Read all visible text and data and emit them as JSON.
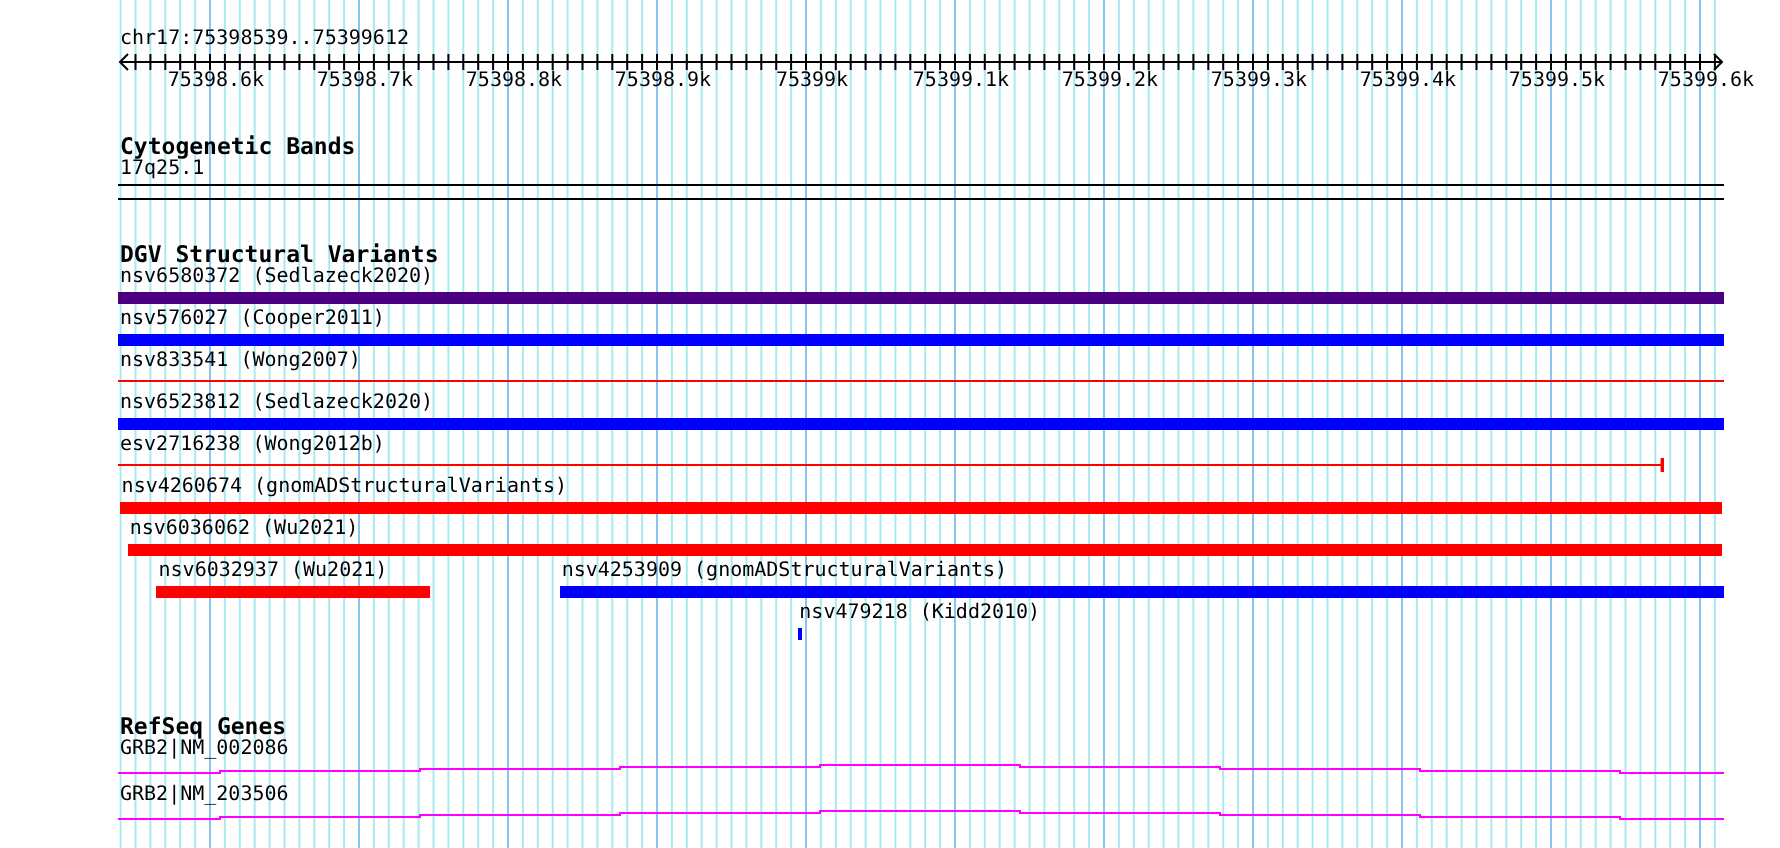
{
  "ruler": {
    "location": "chr17:75398539..75399612",
    "ticks": [
      "75398.6k",
      "75398.7k",
      "75398.8k",
      "75398.9k",
      "75399k",
      "75399.1k",
      "75399.2k",
      "75399.3k",
      "75399.4k",
      "75399.5k",
      "75399.6k"
    ]
  },
  "cytogenetic_bands": {
    "title": "Cytogenetic Bands",
    "band": "17q25.1"
  },
  "dgv": {
    "title": "DGV Structural Variants",
    "features": [
      {
        "label": "nsv6580372 (Sedlazeck2020)",
        "kind": "bar",
        "color": "#4b0082"
      },
      {
        "label": "nsv576027 (Cooper2011)",
        "kind": "bar",
        "color": "#0000ff"
      },
      {
        "label": "nsv833541 (Wong2007)",
        "kind": "line",
        "color": "#ff0000"
      },
      {
        "label": "nsv6523812 (Sedlazeck2020)",
        "kind": "bar",
        "color": "#0000ff"
      },
      {
        "label": "esv2716238 (Wong2012b)",
        "kind": "capped_line",
        "color": "#ff0000"
      },
      {
        "label": "nsv4260674 (gnomADStructuralVariants)",
        "kind": "bar",
        "color": "#ff0000"
      },
      {
        "label": "nsv6036062 (Wu2021)",
        "kind": "bar",
        "color": "#ff0000"
      },
      {
        "label": "nsv6032937 (Wu2021)",
        "kind": "bar",
        "color": "#ff0000"
      },
      {
        "label": "nsv4253909 (gnomADStructuralVariants)",
        "kind": "bar",
        "color": "#0000ff"
      },
      {
        "label": "nsv479218 (Kidd2010)",
        "kind": "bar",
        "color": "#0000ff"
      }
    ]
  },
  "refseq": {
    "title": "RefSeq Genes",
    "genes": [
      "GRB2|NM_002086",
      "GRB2|NM_203506"
    ]
  }
}
